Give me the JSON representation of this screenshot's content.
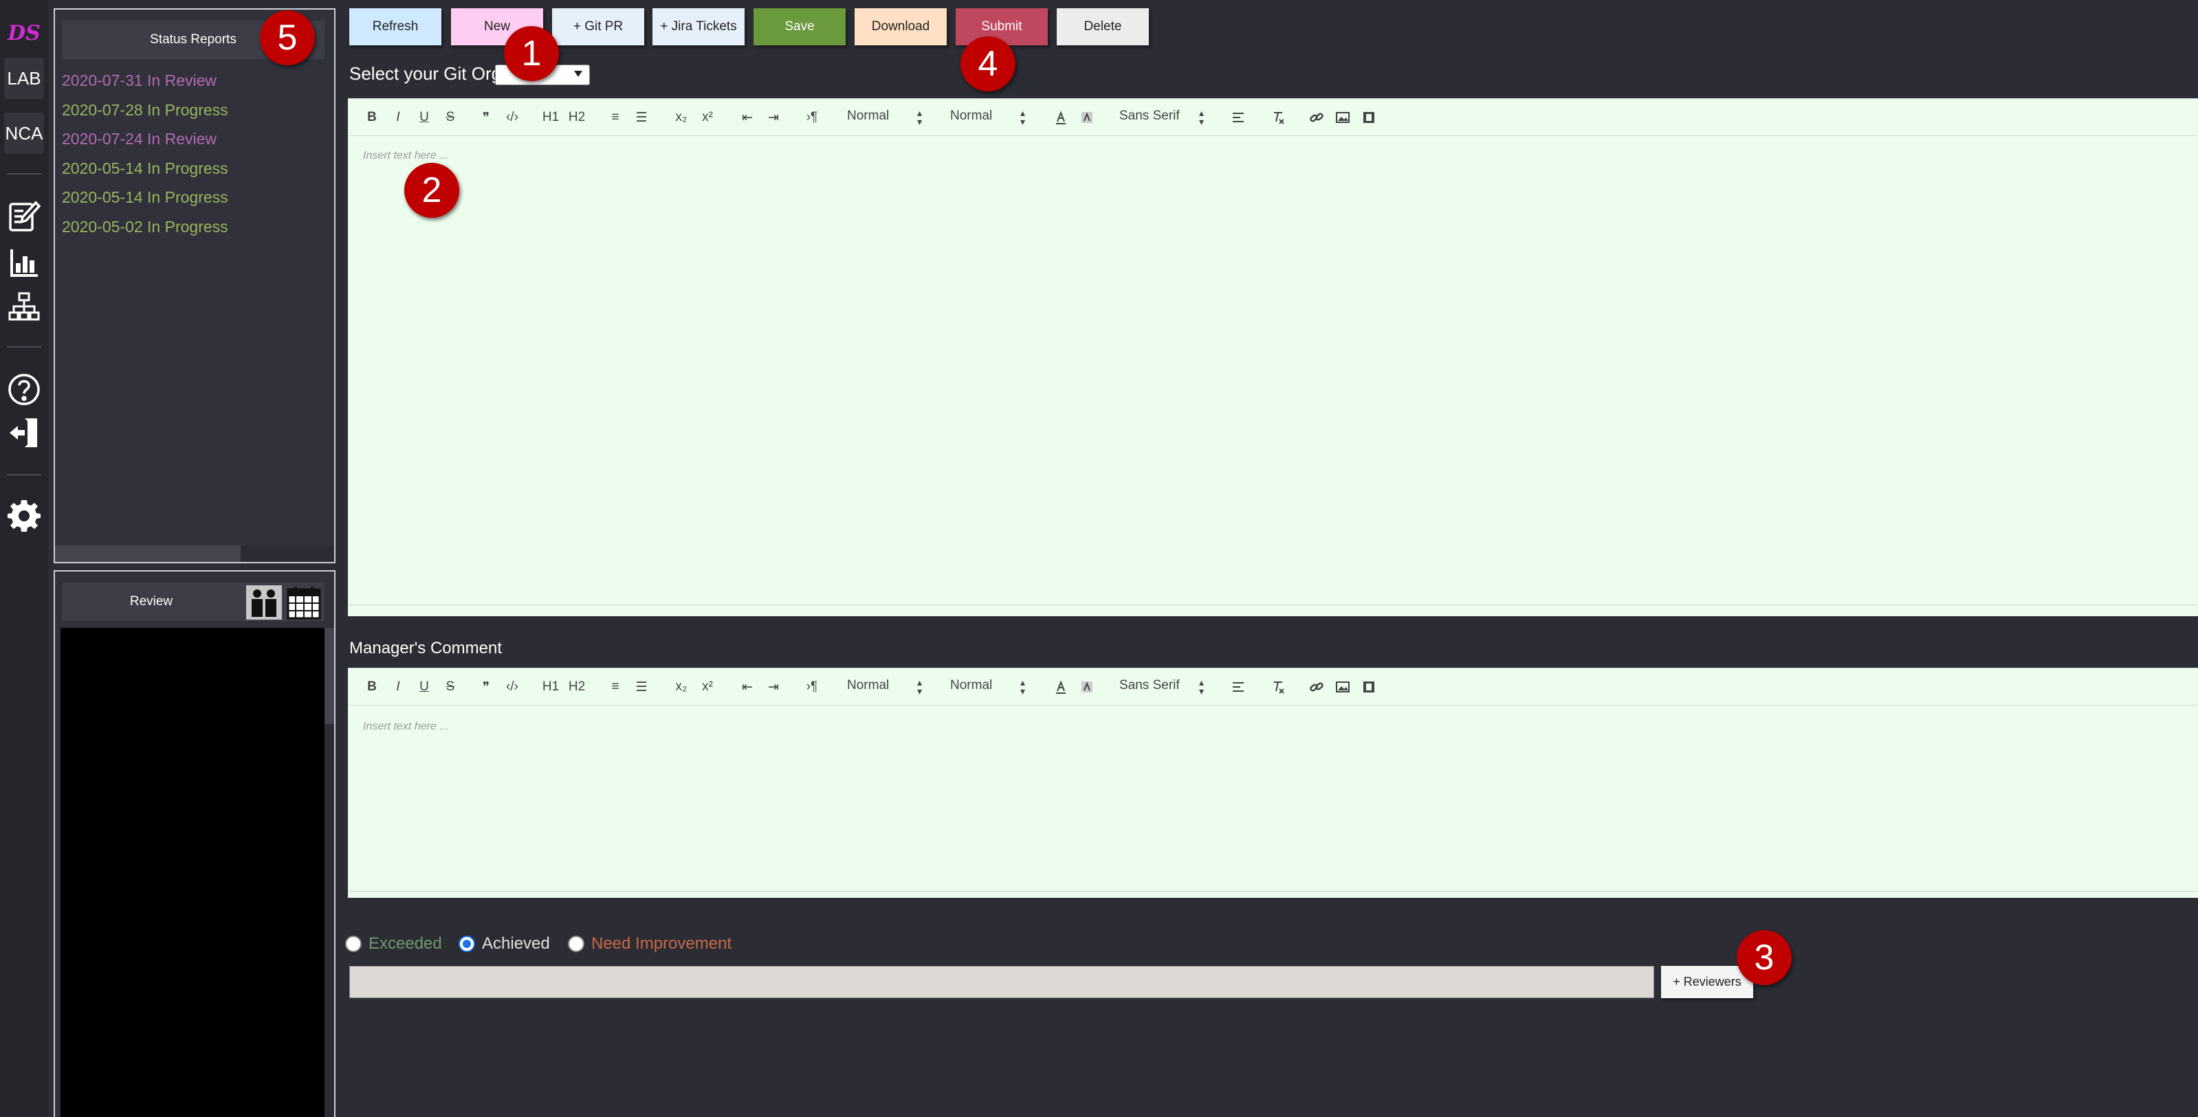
{
  "rail": {
    "logo": "DS",
    "items": [
      "LAB",
      "NCA"
    ],
    "icons": [
      "edit-report-icon",
      "chart-icon",
      "org-chart-icon",
      "help-icon",
      "logout-icon",
      "settings-icon"
    ]
  },
  "status_panel": {
    "title": "Status Reports",
    "reports": [
      {
        "label": "2020-07-31 In Review",
        "state": "review"
      },
      {
        "label": "2020-07-28 In Progress",
        "state": "progress"
      },
      {
        "label": "2020-07-24 In Review",
        "state": "review"
      },
      {
        "label": "2020-05-14 In Progress",
        "state": "progress"
      },
      {
        "label": "2020-05-14 In Progress",
        "state": "progress"
      },
      {
        "label": "2020-05-02 In Progress",
        "state": "progress"
      }
    ]
  },
  "review_panel": {
    "title": "Review",
    "icons": [
      "people-icon",
      "calendar-icon"
    ]
  },
  "toolbar": {
    "buttons": [
      {
        "label": "Refresh",
        "color": "#cfeaff",
        "text": "#222"
      },
      {
        "label": "New",
        "color": "#ffccf2",
        "text": "#222"
      },
      {
        "label": "+ Git PR",
        "color": "#e6f0fb",
        "text": "#222"
      },
      {
        "label": "+ Jira Tickets",
        "color": "#e6f0fb",
        "text": "#222"
      },
      {
        "label": "Save",
        "color": "#6a9a3c",
        "text": "#fff"
      },
      {
        "label": "Download",
        "color": "#ffe0c4",
        "text": "#222"
      },
      {
        "label": "Submit",
        "color": "#c0485e",
        "text": "#fff"
      },
      {
        "label": "Delete",
        "color": "#ececec",
        "text": "#222"
      }
    ]
  },
  "git_org": {
    "label": "Select your Git Org",
    "selected": ""
  },
  "editor_toolbar": {
    "glyphs": [
      "B",
      "I",
      "U",
      "S",
      "❞",
      "‹/›",
      "H1",
      "H2",
      "≡",
      "☰",
      "x₂",
      "x²",
      "⇤",
      "⇥",
      "›¶"
    ],
    "selects": [
      "Normal",
      "Normal",
      "Sans Serif"
    ]
  },
  "report_editor": {
    "placeholder": "Insert text here ..."
  },
  "manager_comment": {
    "label": "Manager's Comment",
    "placeholder": "Insert text here ..."
  },
  "rating": {
    "options": [
      {
        "label": "Exceeded",
        "color": "#6f9a6c",
        "checked": false
      },
      {
        "label": "Achieved",
        "color": "#e2e2e2",
        "checked": true
      },
      {
        "label": "Need Improvement",
        "color": "#c9694a",
        "checked": false
      }
    ]
  },
  "reviewers": {
    "value": "",
    "button_label": "+ Reviewers"
  },
  "markers": [
    "1",
    "2",
    "3",
    "4",
    "5"
  ]
}
